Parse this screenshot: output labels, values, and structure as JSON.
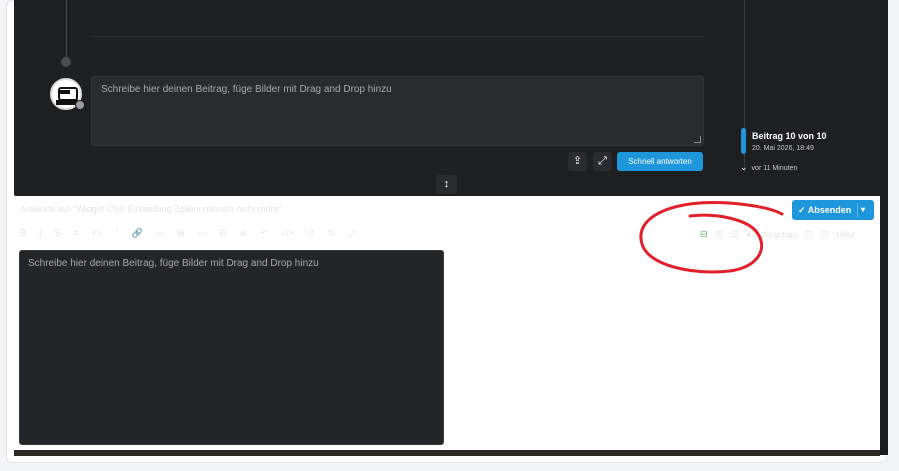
{
  "thread": {
    "composer_placeholder": "Schreibe hier deinen Beitrag, füge Bilder mit Drag and Drop hinzu",
    "quick_reply_label": "Schnell antworten",
    "upload_icon": "upload-icon",
    "expand_icon": "expand-icon"
  },
  "timeline": {
    "post_position": "Beitrag 10 von 10",
    "post_date": "20. Mai 2026, 18:49",
    "ago": "vor 11 Minuten"
  },
  "reply_panel": {
    "title": "Antworte auf \"Widget CSS Einstellung Zeilenumbruch nicht mehr\"",
    "toolbar_items": [
      "B",
      "I",
      "S",
      "≡",
      "<>",
      "\"",
      "🔗",
      "▭",
      "⊞",
      "▭",
      "⊟",
      "⊘",
      "↶",
      "</>",
      "↺",
      "↻",
      "⤢"
    ],
    "toolbar_right": [
      "⊞",
      "☰",
      "▸",
      "Vorschau",
      "⊡",
      "⊟",
      "Hilfe"
    ],
    "submit_label": "Absenden",
    "editor_placeholder": "Schreibe hier deinen Beitrag, füge Bilder mit Drag and Drop hinzu"
  },
  "colors": {
    "accent": "#1e96dc",
    "dark_bg": "#1e1f21",
    "annotation": "#e2202c",
    "save_icon": "#5cb85c"
  }
}
